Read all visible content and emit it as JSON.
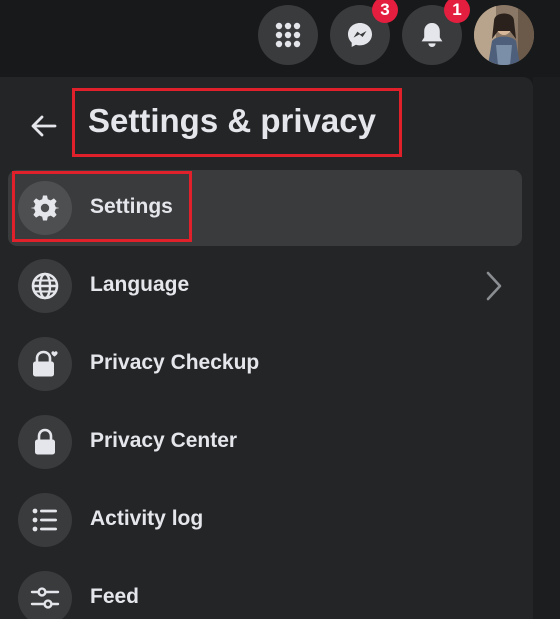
{
  "topbar": {
    "menu_icon": "grid-menu-icon",
    "messenger_icon": "messenger-icon",
    "messenger_badge": "3",
    "notifications_icon": "bell-icon",
    "notifications_badge": "1"
  },
  "header": {
    "back_icon": "arrow-left-icon",
    "title": "Settings & privacy"
  },
  "menu": {
    "items": [
      {
        "label": "Settings",
        "icon": "gear-icon",
        "active": true
      },
      {
        "label": "Language",
        "icon": "globe-icon",
        "has_submenu": true
      },
      {
        "label": "Privacy Checkup",
        "icon": "lock-heart-icon"
      },
      {
        "label": "Privacy Center",
        "icon": "lock-icon"
      },
      {
        "label": "Activity log",
        "icon": "list-icon"
      },
      {
        "label": "Feed",
        "icon": "sliders-icon"
      }
    ]
  },
  "colors": {
    "background": "#18191a",
    "panel": "#242526",
    "button": "#3a3b3c",
    "text": "#e4e6eb",
    "badge": "#e41e3f",
    "highlight_box": "#e0202a"
  }
}
